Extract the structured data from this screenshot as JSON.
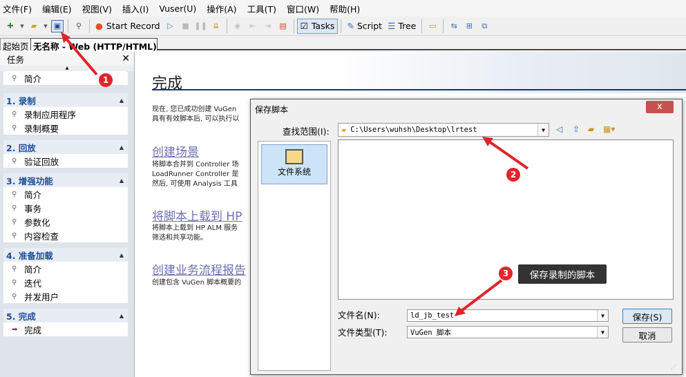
{
  "menubar": [
    "文件(F)",
    "编辑(E)",
    "视图(V)",
    "插入(I)",
    "Vuser(U)",
    "操作(A)",
    "工具(T)",
    "窗口(W)",
    "帮助(H)"
  ],
  "toolbar": {
    "start_record": "Start Record",
    "tasks": "Tasks",
    "script": "Script",
    "tree": "Tree"
  },
  "tabs": {
    "start_page": "起始页",
    "script_tab": "无名称 - Web (HTTP/HTML)"
  },
  "sidebar": {
    "title": "任务",
    "intro": "简介",
    "groups": [
      {
        "title": "1. 录制",
        "items": [
          "录制应用程序",
          "录制概要"
        ]
      },
      {
        "title": "2. 回放",
        "items": [
          "验证回放"
        ]
      },
      {
        "title": "3. 增强功能",
        "items": [
          "简介",
          "事务",
          "参数化",
          "内容检查"
        ]
      },
      {
        "title": "4. 准备加载",
        "items": [
          "简介",
          "迭代",
          "并发用户"
        ]
      },
      {
        "title": "5. 完成",
        "items": [
          "完成"
        ]
      }
    ]
  },
  "main": {
    "title": "完成",
    "para1": [
      "现在, 您已成功创建 VuGen",
      "具有有效脚本后, 可以执行以"
    ],
    "link1": "创建场景",
    "para2": [
      "将脚本合并到 Controller 场",
      "LoadRunner Controller 是",
      "然后, 可使用 Analysis 工具"
    ],
    "link2": "将脚本上载到 HP",
    "para3": [
      "将脚本上载到 HP ALM 服务",
      "筛选和共享功能。"
    ],
    "link3": "创建业务流程报告",
    "para4": [
      "创建包含 VuGen 脚本概要的"
    ]
  },
  "dialog": {
    "title": "保存脚本",
    "lookin_label": "查找范围(I):",
    "lookin_value": "C:\\Users\\wuhsh\\Desktop\\lrtest",
    "place": "文件系统",
    "filename_label": "文件名(N):",
    "filename_value": "ld_jb_test",
    "filetype_label": "文件类型(T):",
    "filetype_value": "VuGen 脚本",
    "save": "保存(S)",
    "cancel": "取消",
    "close": "x"
  },
  "annotations": {
    "badge1": "1",
    "badge2": "2",
    "badge3": "3",
    "callout": "保存录制的脚本"
  }
}
